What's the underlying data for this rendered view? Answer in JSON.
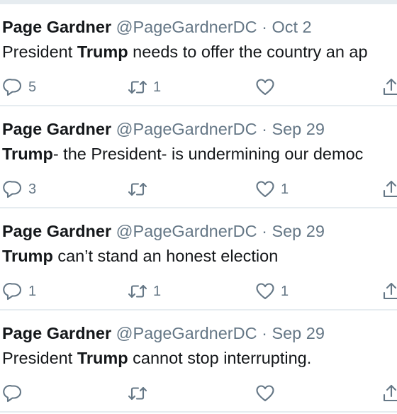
{
  "tweets": [
    {
      "name": "Page Gardner",
      "handle": "@PageGardnerDC",
      "separator": "·",
      "date": "Oct 2",
      "text_pre": "President ",
      "text_bold": "Trump",
      "text_post": " needs to offer the country an ap",
      "replies": "5",
      "retweets": "1",
      "likes": ""
    },
    {
      "name": "Page Gardner",
      "handle": "@PageGardnerDC",
      "separator": "·",
      "date": "Sep 29",
      "text_pre": "",
      "text_bold": "Trump",
      "text_post": "- the President- is undermining our democ",
      "replies": "3",
      "retweets": "",
      "likes": "1"
    },
    {
      "name": "Page Gardner",
      "handle": "@PageGardnerDC",
      "separator": "·",
      "date": "Sep 29",
      "text_pre": "",
      "text_bold": "Trump",
      "text_post": " can’t stand an honest election",
      "replies": "1",
      "retweets": "1",
      "likes": "1"
    },
    {
      "name": "Page Gardner",
      "handle": "@PageGardnerDC",
      "separator": "·",
      "date": "Sep 29",
      "text_pre": "President ",
      "text_bold": "Trump",
      "text_post": " cannot stop interrupting.",
      "replies": "",
      "retweets": "",
      "likes": ""
    }
  ],
  "icons": {
    "reply": "reply-icon",
    "retweet": "retweet-icon",
    "like": "heart-icon",
    "share": "share-icon"
  },
  "colors": {
    "text": "#14171a",
    "secondary": "#657786",
    "divider": "#e6ecf0"
  }
}
